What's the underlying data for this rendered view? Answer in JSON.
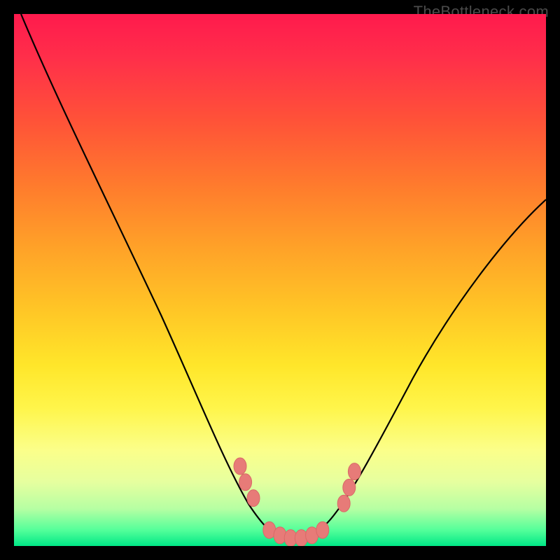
{
  "watermark": "TheBottleneck.com",
  "chart_data": {
    "type": "line",
    "title": "",
    "xlabel": "",
    "ylabel": "",
    "xlim": [
      0,
      100
    ],
    "ylim": [
      0,
      100
    ],
    "grid": false,
    "legend": false,
    "background": {
      "type": "vertical-gradient",
      "meaning": "green (bottom) = good / low bottleneck, red (top) = bad / high bottleneck",
      "stops": [
        {
          "pos": 0.0,
          "color": "#ff1a4d"
        },
        {
          "pos": 0.5,
          "color": "#ffc726"
        },
        {
          "pos": 0.82,
          "color": "#fbff8a"
        },
        {
          "pos": 1.0,
          "color": "#00e886"
        }
      ]
    },
    "series": [
      {
        "name": "bottleneck-curve",
        "x": [
          0,
          3,
          8,
          14,
          20,
          26,
          32,
          37,
          42,
          45,
          48,
          50,
          52,
          54,
          57,
          60,
          63,
          66,
          70,
          75,
          82,
          90,
          100
        ],
        "values": [
          100,
          95,
          85,
          74,
          62,
          50,
          38,
          27,
          17,
          10,
          5,
          2,
          1,
          2,
          4,
          7,
          10,
          14,
          19,
          27,
          37,
          48,
          60
        ]
      }
    ],
    "markers": [
      {
        "name": "left-cluster-top",
        "x": 42.5,
        "y": 15
      },
      {
        "name": "left-cluster-mid",
        "x": 43.5,
        "y": 12
      },
      {
        "name": "left-cluster-low",
        "x": 45.0,
        "y": 9
      },
      {
        "name": "valley-1",
        "x": 48.0,
        "y": 3
      },
      {
        "name": "valley-2",
        "x": 50.0,
        "y": 2
      },
      {
        "name": "valley-3",
        "x": 52.0,
        "y": 1.5
      },
      {
        "name": "valley-4",
        "x": 54.0,
        "y": 1.5
      },
      {
        "name": "valley-5",
        "x": 56.0,
        "y": 2
      },
      {
        "name": "valley-6",
        "x": 58.0,
        "y": 3
      },
      {
        "name": "right-cluster-low",
        "x": 62.0,
        "y": 8
      },
      {
        "name": "right-cluster-mid",
        "x": 63.0,
        "y": 11
      },
      {
        "name": "right-cluster-top",
        "x": 64.0,
        "y": 14
      }
    ],
    "annotations": []
  }
}
